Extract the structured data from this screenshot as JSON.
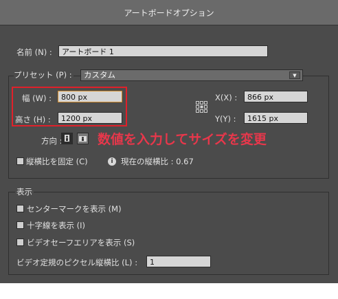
{
  "dialog": {
    "title": "アートボードオプション"
  },
  "name": {
    "label": "名前 (N) :",
    "value": "アートボード 1"
  },
  "preset": {
    "label": "プリセット (P) :",
    "value": "カスタム"
  },
  "width": {
    "label": "幅 (W) :",
    "value": "800 px"
  },
  "height": {
    "label": "高さ (H) :",
    "value": "1200 px"
  },
  "x": {
    "label": "X(X) :",
    "value": "866 px"
  },
  "y": {
    "label": "Y(Y) :",
    "value": "1615 px"
  },
  "orientation": {
    "label": "方向 :"
  },
  "annotation": {
    "text": "数値を入力してサイズを変更",
    "color": "#e8374b"
  },
  "aspect": {
    "lock_label": "縦横比を固定 (C)",
    "current_label": "現在の縦横比 : 0.67"
  },
  "display": {
    "group_title": "表示",
    "center_mark": "センターマークを表示 (M)",
    "cross_hairs": "十字線を表示 (I)",
    "video_safe": "ビデオセーフエリアを表示 (S)",
    "pixel_ratio_label": "ビデオ定規のピクセル縦横比 (L) :",
    "pixel_ratio_value": "1"
  },
  "icons": [
    "reference-point-icon",
    "portrait-orientation-icon",
    "landscape-orientation-icon",
    "info-icon",
    "dropdown-arrow-icon"
  ],
  "colors": {
    "dialog_bg": "#4b4b4b",
    "titlebar_bg": "#6a6a6a",
    "highlight": "#e0202a"
  }
}
